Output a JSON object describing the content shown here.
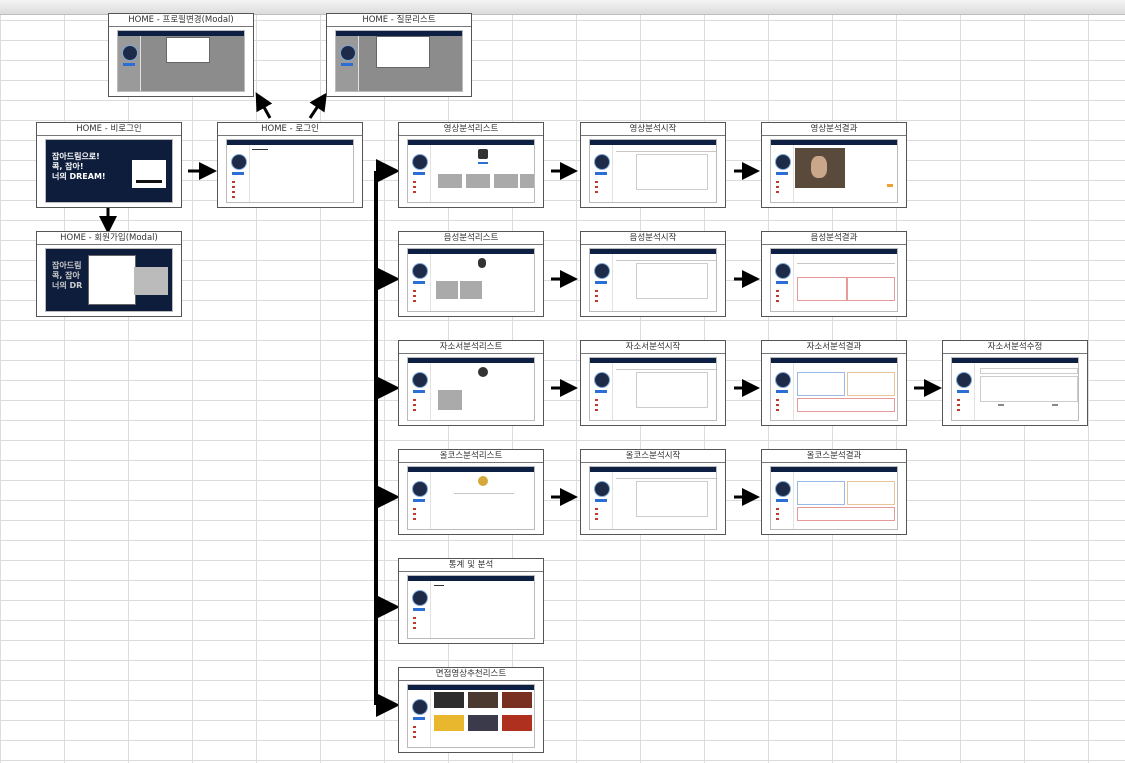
{
  "cards": {
    "home_profile_modal": "HOME - 프로필변경(Modal)",
    "home_question_list": "HOME - 질문리스트",
    "home_logged_out": "HOME - 비로그인",
    "home_logged_in": "HOME - 로그인",
    "home_signup_modal": "HOME - 회원가입(Modal)",
    "video_list": "영상분석리스트",
    "video_start": "영상분석시작",
    "video_result": "영상분석결과",
    "voice_list": "음성분석리스트",
    "voice_start": "음성분석시작",
    "voice_result": "음성분석결과",
    "essay_list": "자소서분석리스트",
    "essay_start": "자소서분석시작",
    "essay_result": "자소서분석결과",
    "essay_edit": "자소서분석수정",
    "course_list": "올코스분석리스트",
    "course_start": "올코스분석시작",
    "course_result": "올코스분석결과",
    "stats": "통계 및 분석",
    "recommend": "면접영상추천리스트"
  },
  "hero": {
    "line1": "잡아드림으로!",
    "line2": "콕, 잡아!",
    "line3": "너의 DREAM!",
    "signup_line1": "잡아드림",
    "signup_line2": "콕, 잡아",
    "signup_line3": "너의 DR"
  },
  "colors": {
    "navy": "#0e1f44",
    "accent_blue": "#2b6fd6",
    "arrow": "#000000"
  }
}
